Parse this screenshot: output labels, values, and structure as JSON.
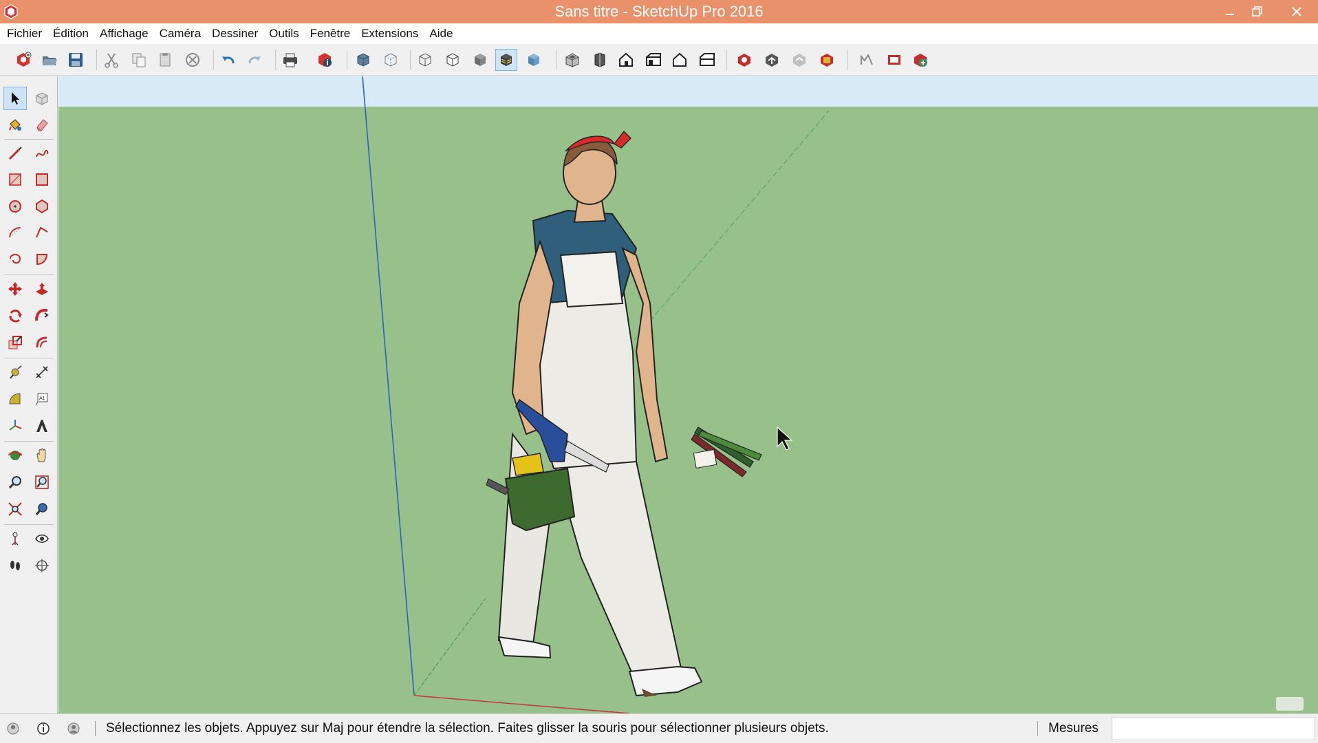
{
  "window": {
    "title": "Sans titre - SketchUp Pro 2016",
    "controls": [
      "minimize-icon",
      "restore-icon",
      "close-icon"
    ]
  },
  "menu": {
    "items": [
      "Fichier",
      "Édition",
      "Affichage",
      "Caméra",
      "Dessiner",
      "Outils",
      "Fenêtre",
      "Extensions",
      "Aide"
    ]
  },
  "toolbar": {
    "icons": [
      "new-file-icon",
      "open-file-icon",
      "save-icon",
      "cut-icon",
      "copy-icon",
      "paste-icon",
      "erase-icon",
      "undo-icon",
      "redo-icon",
      "print-icon",
      "model-info-icon",
      "xray-icon",
      "back-edges-icon",
      "wireframe-icon",
      "hidden-line-icon",
      "shaded-icon",
      "shaded-textures-icon",
      "monochrome-icon",
      "iso-view-icon",
      "top-view-icon",
      "front-view-icon",
      "right-view-icon",
      "back-view-icon",
      "left-view-icon",
      "3d-warehouse-icon",
      "share-model-icon",
      "share-component-icon",
      "extension-warehouse-icon",
      "layout-icon",
      "send-to-layout-icon",
      "extension-manager-icon"
    ],
    "active_icon": "shaded-textures-icon"
  },
  "palette": {
    "tools": [
      "select-tool-icon",
      "make-component-icon",
      "paint-bucket-icon",
      "eraser-icon",
      "line-tool-icon",
      "freehand-icon",
      "rectangle-icon",
      "rotated-rectangle-icon",
      "circle-icon",
      "polygon-icon",
      "arc-icon",
      "two-point-arc-icon",
      "three-point-arc-icon",
      "pie-icon",
      "move-icon",
      "push-pull-icon",
      "rotate-icon",
      "follow-me-icon",
      "scale-icon",
      "offset-icon",
      "tape-measure-icon",
      "dimension-icon",
      "protractor-icon",
      "text-icon",
      "axes-icon",
      "3d-text-icon",
      "orbit-icon",
      "pan-icon",
      "zoom-icon",
      "zoom-window-icon",
      "zoom-extents-icon",
      "previous-view-icon",
      "position-camera-icon",
      "look-around-icon",
      "walk-icon",
      "section-plane-icon"
    ],
    "active_tool": "select-tool-icon"
  },
  "scene": {
    "sky_color": "#d7eaf6",
    "ground_color": "#98c08a",
    "figure": "woman-in-overalls-with-toolbox"
  },
  "status": {
    "icons": [
      "geo-location-icon",
      "credits-icon",
      "user-icon"
    ],
    "message": "Sélectionnez les objets. Appuyez sur Maj pour étendre la sélection. Faites glisser la souris pour sélectionner plusieurs objets.",
    "measures_label": "Mesures",
    "measures_value": ""
  }
}
